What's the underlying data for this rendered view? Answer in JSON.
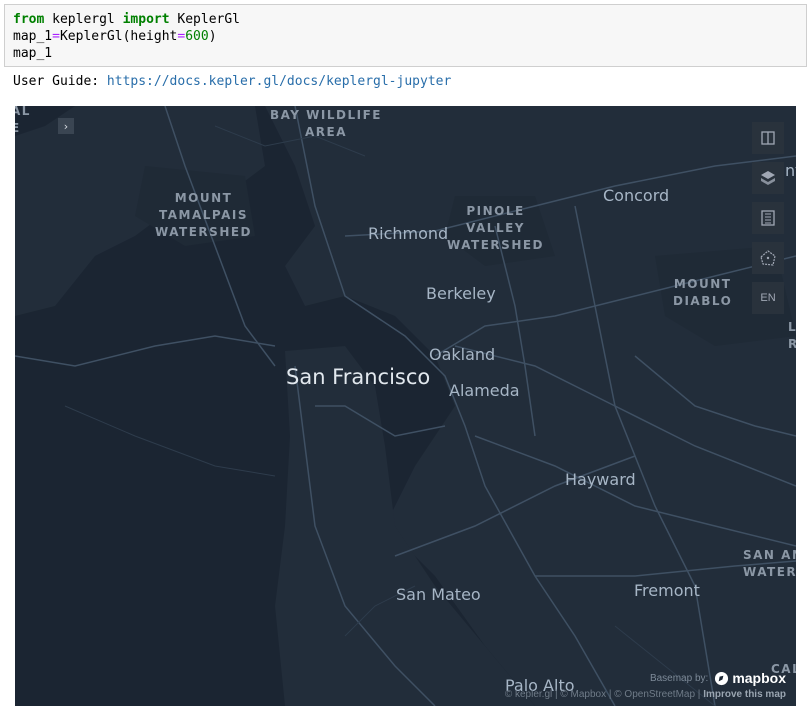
{
  "cell": {
    "line1": {
      "kw1": "from",
      "mid1": " keplergl ",
      "kw2": "import",
      "mid2": " KeplerGl"
    },
    "line2": {
      "a": "map_1",
      "op1": "=",
      "b": "KeplerGl(height",
      "op2": "=",
      "num": "600",
      "c": ")"
    },
    "line3": "map_1"
  },
  "output": {
    "label": "User Guide: ",
    "link": "https://docs.kepler.gl/docs/keplergl-jupyter"
  },
  "map": {
    "areas": {
      "bay_wildlife": "BAY WILDLIFE\nAREA",
      "tamalpais": "MOUNT\nTAMALPAIS\nWATERSHED",
      "pinole": "PINOLE\nVALLEY\nWATERSHED",
      "diablo": "MOUNT\nDIABLO",
      "san_antonio": "SAN AN\nWATER",
      "left_edge": "AL\nE",
      "right_edge": "L\nR",
      "right_bottom": "CAL"
    },
    "cities": {
      "concord": "Concord",
      "richmond": "Richmond",
      "berkeley": "Berkeley",
      "oakland": "Oakland",
      "san_francisco": "San Francisco",
      "alameda": "Alameda",
      "hayward": "Hayward",
      "san_mateo": "San Mateo",
      "fremont": "Fremont",
      "palo_alto": "Palo Alto",
      "edge_nt": "nt"
    },
    "controls": {
      "split_icon": "split-map-icon",
      "layers_icon": "layers-icon",
      "legend_icon": "legend-icon",
      "draw_icon": "draw-polygon-icon",
      "lang": "EN",
      "collapse": "›"
    },
    "attribution": {
      "basemap_by": "Basemap by:",
      "brand": "mapbox",
      "kepler": "© kepler.gl",
      "mapbox": "© Mapbox",
      "osm": "© OpenStreetMap",
      "improve": "Improve this map"
    },
    "colors": {
      "water": "#1b2532",
      "land": "#222d3a",
      "roads": "#3f5063"
    }
  }
}
